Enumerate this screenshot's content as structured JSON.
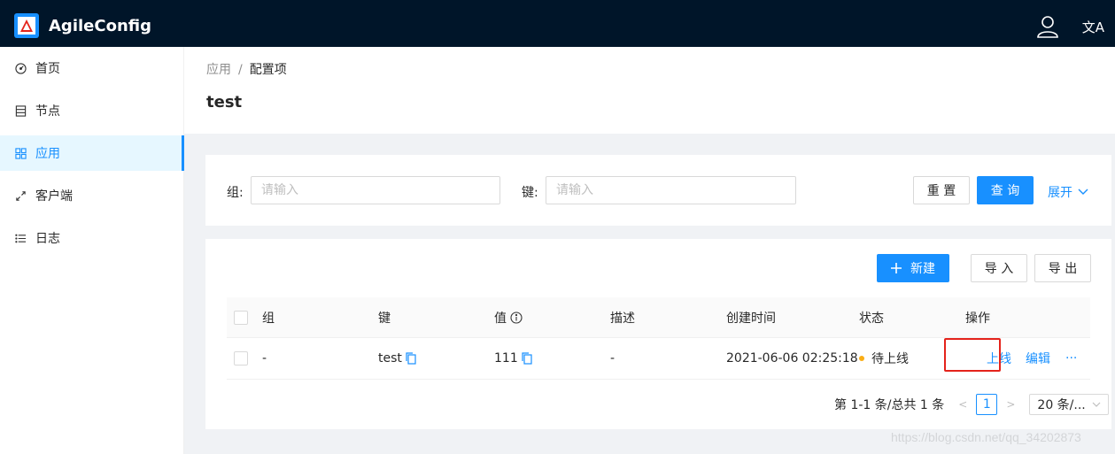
{
  "header": {
    "app_name": "AgileConfig",
    "user_icon": "user-icon",
    "lang_icon_text": "文A"
  },
  "sidebar": {
    "items": [
      {
        "label": "首页",
        "icon": "dashboard-icon"
      },
      {
        "label": "节点",
        "icon": "nodes-icon"
      },
      {
        "label": "应用",
        "icon": "apps-icon",
        "active": true
      },
      {
        "label": "客户端",
        "icon": "client-icon"
      },
      {
        "label": "日志",
        "icon": "log-icon"
      }
    ]
  },
  "breadcrumb": {
    "parent": "应用",
    "separator": "/",
    "current": "配置项"
  },
  "page": {
    "title": "test"
  },
  "search": {
    "group_label": "组:",
    "group_placeholder": "请输入",
    "key_label": "键:",
    "key_placeholder": "请输入",
    "reset_label": "重 置",
    "query_label": "查 询",
    "expand_label": "展开"
  },
  "toolbar": {
    "new_label": "新建",
    "import_label": "导 入",
    "export_label": "导 出"
  },
  "table": {
    "columns": [
      "组",
      "键",
      "值",
      "描述",
      "创建时间",
      "状态",
      "操作"
    ],
    "rows": [
      {
        "group": "-",
        "key": "test",
        "value": "111",
        "description": "-",
        "created": "2021-06-06 02:25:18",
        "status": "待上线",
        "action_online": "上线",
        "action_edit": "编辑",
        "action_more": "···"
      }
    ]
  },
  "pagination": {
    "summary": "第 1-1 条/总共 1 条",
    "current_page": "1",
    "page_size": "20 条/..."
  },
  "watermark": "https://blog.csdn.net/qq_34202873",
  "colors": {
    "primary": "#1890ff",
    "header_bg": "#001529",
    "status_pending": "#faad14",
    "highlight": "#e4231b"
  }
}
